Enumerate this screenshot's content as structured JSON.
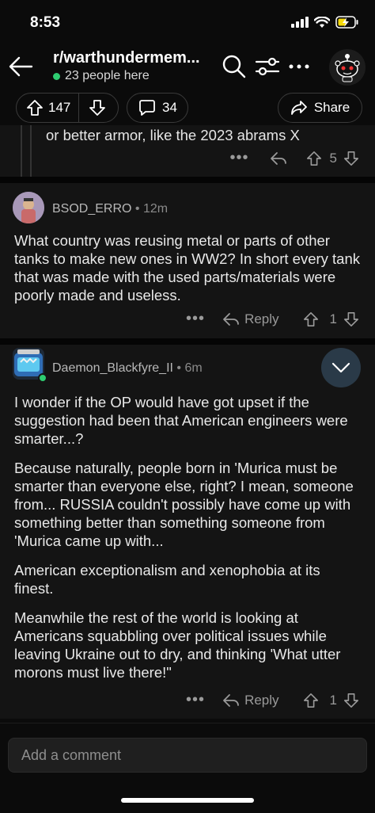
{
  "status_bar": {
    "time": "8:53"
  },
  "header": {
    "subreddit": "r/warthundermem...",
    "online": "23 people here"
  },
  "post_actions": {
    "votes": "147",
    "comments": "34",
    "share_label": "Share"
  },
  "partial_comment": {
    "text": "or better armor, like the 2023 abrams X",
    "votes": "5"
  },
  "comments": [
    {
      "author": "BSOD_ERRO",
      "age": "12m",
      "paragraphs": [
        "What country was reusing metal or parts of other tanks to make new ones in WW2? In short every tank that was made with the used parts/materials were poorly made and useless."
      ],
      "reply_label": "Reply",
      "votes": "1"
    },
    {
      "author": "Daemon_Blackfyre_II",
      "age": "6m",
      "paragraphs": [
        "I wonder if the OP would have got upset if the suggestion had been that American engineers were smarter...?",
        "Because naturally, people born in 'Murica must be smarter than everyone else, right? I mean, someone from... RUSSIA couldn't possibly have come up with something better than something someone from 'Murica came up with...",
        "American exceptionalism and xenophobia at its finest.",
        "Meanwhile the rest of the world is looking at Americans squabbling over political issues while leaving Ukraine out to dry, and thinking 'What utter morons must live there!\""
      ],
      "reply_label": "Reply",
      "votes": "1"
    }
  ],
  "comment_input": {
    "placeholder": "Add a comment"
  },
  "colors": {
    "online_dot": "#2ecc71",
    "collapse_bg": "#2a3a48"
  }
}
